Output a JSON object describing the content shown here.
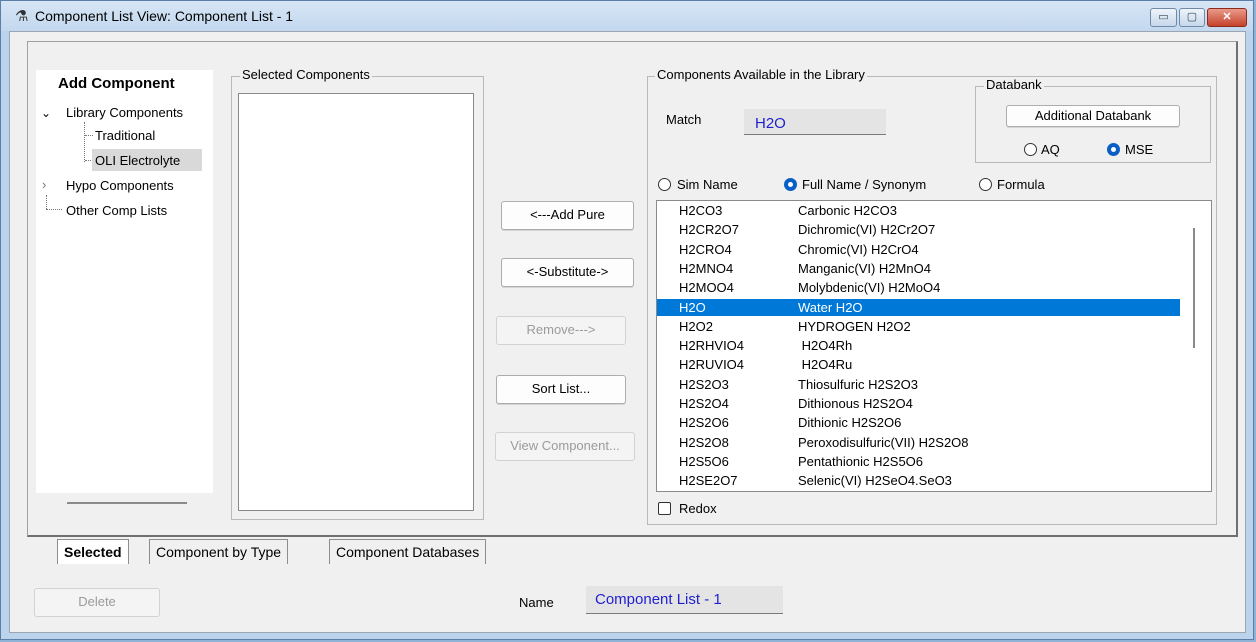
{
  "window": {
    "title": "Component List View: Component List - 1",
    "icon": "flask-icon",
    "minimize_glyph": "▭",
    "maximize_glyph": "▢",
    "close_glyph": "✕"
  },
  "add_component": {
    "heading": "Add Component",
    "tree": [
      {
        "label": "Library Components",
        "expanded": true
      },
      {
        "label": "Traditional"
      },
      {
        "label": "OLI Electrolyte",
        "selected": true
      },
      {
        "label": "Hypo Components",
        "expanded": false
      },
      {
        "label": "Other Comp Lists"
      }
    ]
  },
  "selected_components": {
    "label": "Selected Components"
  },
  "actions": {
    "add_pure": "<---Add Pure",
    "substitute": "<-Substitute->",
    "remove": "Remove--->",
    "sort_list": "Sort List...",
    "view_component": "View Component..."
  },
  "library": {
    "label": "Components Available in the Library",
    "match_label": "Match",
    "match_value": "H2O",
    "databank": {
      "label": "Databank",
      "additional_button": "Additional Databank",
      "options": [
        {
          "label": "AQ",
          "checked": false
        },
        {
          "label": "MSE",
          "checked": true
        }
      ]
    },
    "filter_options": [
      {
        "label": "Sim Name",
        "checked": false
      },
      {
        "label": "Full Name / Synonym",
        "checked": true
      },
      {
        "label": "Formula",
        "checked": false
      }
    ],
    "components": [
      {
        "sim": "H2CO3",
        "name": "Carbonic H2CO3"
      },
      {
        "sim": "H2CR2O7",
        "name": "Dichromic(VI) H2Cr2O7"
      },
      {
        "sim": "H2CRO4",
        "name": "Chromic(VI) H2CrO4"
      },
      {
        "sim": "H2MNO4",
        "name": "Manganic(VI) H2MnO4"
      },
      {
        "sim": "H2MOO4",
        "name": "Molybdenic(VI) H2MoO4"
      },
      {
        "sim": "H2O",
        "name": "Water H2O",
        "selected": true
      },
      {
        "sim": "H2O2",
        "name": "HYDROGEN H2O2"
      },
      {
        "sim": "H2RHVIO4",
        "name": " H2O4Rh"
      },
      {
        "sim": "H2RUVIO4",
        "name": " H2O4Ru"
      },
      {
        "sim": "H2S2O3",
        "name": "Thiosulfuric H2S2O3"
      },
      {
        "sim": "H2S2O4",
        "name": "Dithionous H2S2O4"
      },
      {
        "sim": "H2S2O6",
        "name": "Dithionic H2S2O6"
      },
      {
        "sim": "H2S2O8",
        "name": "Peroxodisulfuric(VII) H2S2O8"
      },
      {
        "sim": "H2S5O6",
        "name": "Pentathionic H2S5O6"
      },
      {
        "sim": "H2SE2O7",
        "name": "Selenic(VI) H2SeO4.SeO3"
      }
    ],
    "redox_label": "Redox"
  },
  "tabs": [
    {
      "label": "Selected",
      "active": true
    },
    {
      "label": "Component by Type"
    },
    {
      "label": "Component Databases"
    }
  ],
  "footer": {
    "delete_button": "Delete",
    "name_label": "Name",
    "name_value": "Component List - 1"
  },
  "colors": {
    "selection": "#0078d7",
    "input_text": "#1f1fd0",
    "title_bar": "#c3d7ee"
  }
}
